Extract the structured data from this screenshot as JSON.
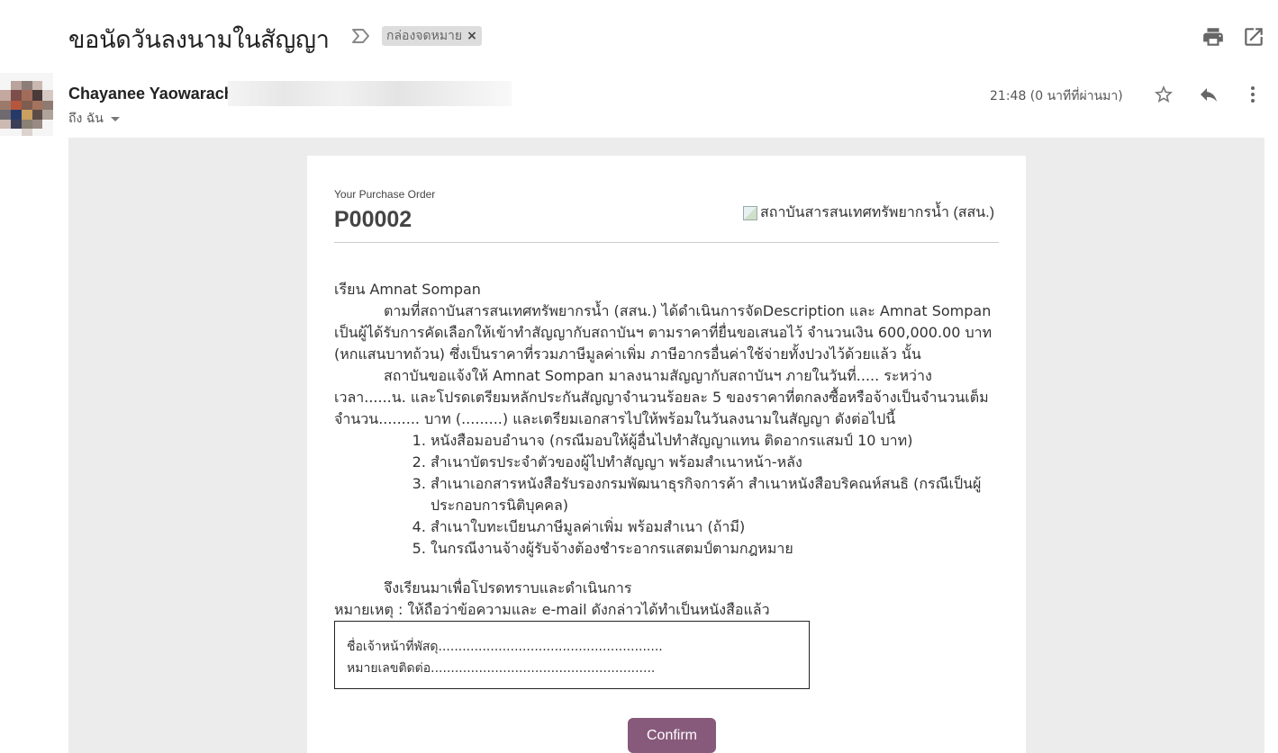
{
  "email": {
    "subject": "ขอนัดวันลงนามในสัญญา",
    "label_chip": "กล่องจดหมาย",
    "label_remove": "×",
    "sender_name": "Chayanee Yaowarach",
    "to_me": "ถึง ฉัน",
    "time": "21:48 (0 นาทีที่ผ่านมา)"
  },
  "icons": {
    "importance": "importance-marker-icon",
    "print": "print-icon",
    "open_new_window": "open-in-new-window-icon",
    "star": "star-icon",
    "reply": "reply-icon",
    "more": "more-vertical-icon",
    "dropdown": "caret-down-icon"
  },
  "purchase_order": {
    "caption": "Your Purchase Order",
    "number": "P00002",
    "logo_alt": "สถาบันสารสนเทศทรัพยากรน้ำ (สสน.)"
  },
  "letter": {
    "greeting": "เรียน Amnat Sompan",
    "para1": "ตามที่สถาบันสารสนเทศทรัพยากรน้ำ (สสน.) ได้ดำเนินการจัดDescription และ Amnat Sompan เป็นผู้ได้รับการคัดเลือกให้เข้าทำสัญญากับสถาบันฯ ตามราคาที่ยื่นขอเสนอไว้ จำนวนเงิน 600,000.00 บาท (หกแสนบาทถ้วน) ซึ่งเป็นราคาที่รวมภาษีมูลค่าเพิ่ม ภาษีอากรอื่นค่าใช้จ่ายทั้งปวงไว้ด้วยแล้ว นั้น",
    "para2": "สถาบันขอแจ้งให้ Amnat Sompan มาลงนามสัญญากับสถาบันฯ ภายในวันที่..... ระหว่างเวลา......น. และโปรดเตรียมหลักประกันสัญญาจำนวนร้อยละ 5 ของราคาที่ตกลงซื้อหรือจ้างเป็นจำนวนเต็ม จำนวน......... บาท (.........) และเตรียมเอกสารไปให้พร้อมในวันลงนามในสัญญา ดังต่อไปนี้",
    "items": [
      "หนังสือมอบอำนาจ (กรณีมอบให้ผู้อื่นไปทำสัญญาแทน ติดอากรแสมป์ 10 บาท)",
      "สำเนาบัตรประจำตัวของผู้ไปทำสัญญา พร้อมสำเนาหน้า-หลัง",
      "สำเนาเอกสารหนังสือรับรองกรมพัฒนาธุรกิจการค้า สำเนาหนังสือบริคณห์สนธิ (กรณีเป็นผู้ประกอบการนิติบุคคล)",
      "สำเนาใบทะเบียนภาษีมูลค่าเพิ่ม พร้อมสำเนา (ถ้ามี)",
      "ในกรณีงานจ้างผู้รับจ้างต้องชำระอากรแสตมป์ตามกฎหมาย"
    ],
    "closing": "จึงเรียนมาเพื่อโปรดทราบและดำเนินการ",
    "note": "หมายเหตุ : ให้ถือว่าข้อความและ e-mail ดังกล่าวได้ทำเป็นหนังสือแล้ว",
    "officer_line": "ชื่อเจ้าหน้าที่พัสดุ........................................................",
    "contact_line": "หมายเลขติดต่อ........................................................"
  },
  "actions": {
    "confirm": "Confirm"
  }
}
